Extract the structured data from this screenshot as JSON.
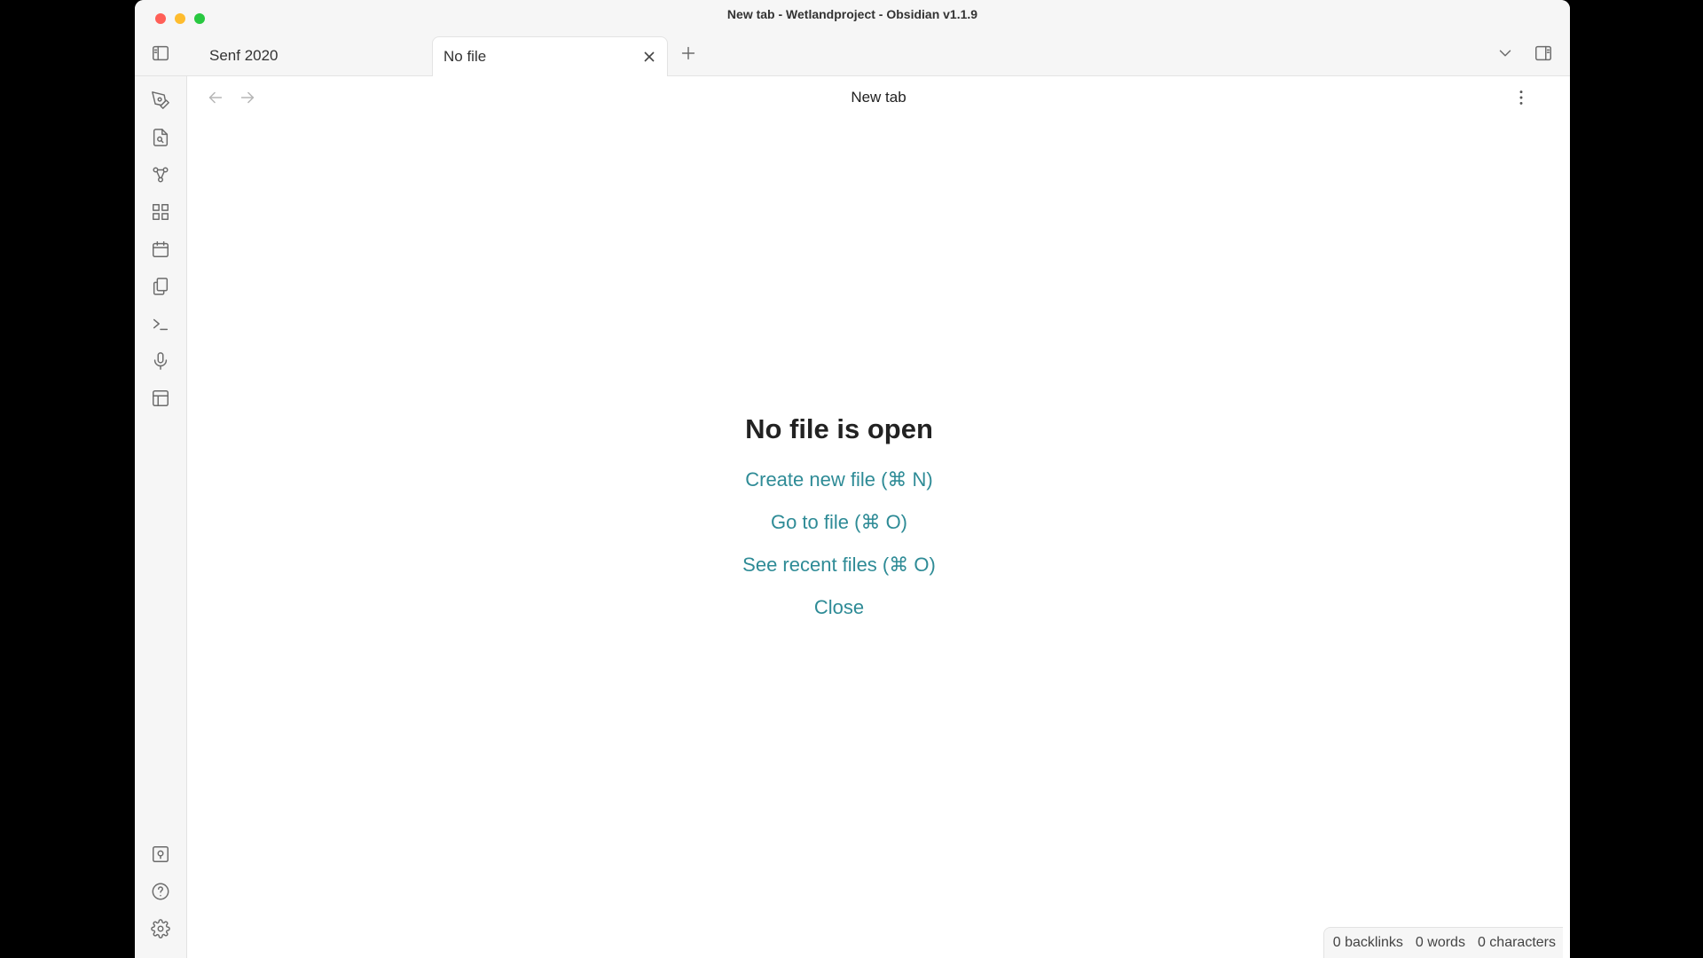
{
  "window": {
    "title": "New tab - Wetlandproject - Obsidian v1.1.9"
  },
  "colors": {
    "traffic_close": "#ff5f57",
    "traffic_minimize": "#febc2e",
    "traffic_zoom": "#28c840",
    "link_accent": "#2e8b96"
  },
  "tabs": [
    {
      "label": "Senf 2020"
    },
    {
      "label": "No file"
    }
  ],
  "view_header": {
    "title": "New tab"
  },
  "ribbon": {
    "top_icons": [
      "pen-tool-icon",
      "file-search-icon",
      "graph-view-icon",
      "grid-icon",
      "calendar-icon",
      "copy-files-icon",
      "terminal-icon",
      "microphone-icon",
      "layout-template-icon"
    ],
    "bottom_icons": [
      "vault-switch-icon",
      "help-icon",
      "settings-icon"
    ]
  },
  "empty_state": {
    "title": "No file is open",
    "actions": [
      {
        "label": "Create new file (⌘ N)"
      },
      {
        "label": "Go to file (⌘ O)"
      },
      {
        "label": "See recent files (⌘ O)"
      },
      {
        "label": "Close"
      }
    ]
  },
  "status_bar": {
    "backlinks": "0 backlinks",
    "words": "0 words",
    "characters": "0 characters"
  }
}
